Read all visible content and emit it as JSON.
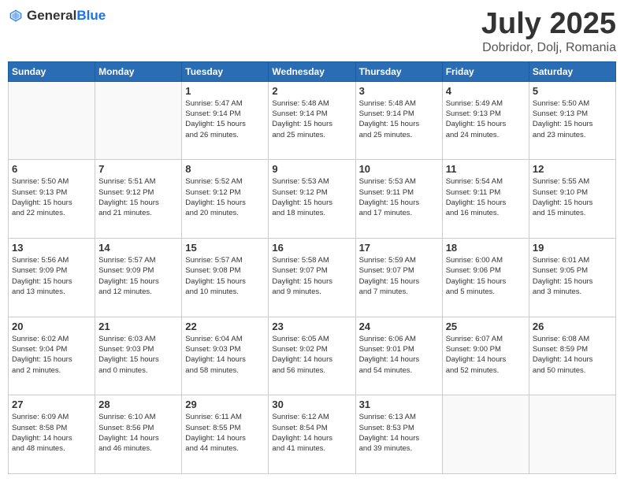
{
  "header": {
    "logo_general": "General",
    "logo_blue": "Blue",
    "main_title": "July 2025",
    "subtitle": "Dobridor, Dolj, Romania"
  },
  "weekdays": [
    "Sunday",
    "Monday",
    "Tuesday",
    "Wednesday",
    "Thursday",
    "Friday",
    "Saturday"
  ],
  "weeks": [
    [
      {
        "day": "",
        "info": ""
      },
      {
        "day": "",
        "info": ""
      },
      {
        "day": "1",
        "info": "Sunrise: 5:47 AM\nSunset: 9:14 PM\nDaylight: 15 hours\nand 26 minutes."
      },
      {
        "day": "2",
        "info": "Sunrise: 5:48 AM\nSunset: 9:14 PM\nDaylight: 15 hours\nand 25 minutes."
      },
      {
        "day": "3",
        "info": "Sunrise: 5:48 AM\nSunset: 9:14 PM\nDaylight: 15 hours\nand 25 minutes."
      },
      {
        "day": "4",
        "info": "Sunrise: 5:49 AM\nSunset: 9:13 PM\nDaylight: 15 hours\nand 24 minutes."
      },
      {
        "day": "5",
        "info": "Sunrise: 5:50 AM\nSunset: 9:13 PM\nDaylight: 15 hours\nand 23 minutes."
      }
    ],
    [
      {
        "day": "6",
        "info": "Sunrise: 5:50 AM\nSunset: 9:13 PM\nDaylight: 15 hours\nand 22 minutes."
      },
      {
        "day": "7",
        "info": "Sunrise: 5:51 AM\nSunset: 9:12 PM\nDaylight: 15 hours\nand 21 minutes."
      },
      {
        "day": "8",
        "info": "Sunrise: 5:52 AM\nSunset: 9:12 PM\nDaylight: 15 hours\nand 20 minutes."
      },
      {
        "day": "9",
        "info": "Sunrise: 5:53 AM\nSunset: 9:12 PM\nDaylight: 15 hours\nand 18 minutes."
      },
      {
        "day": "10",
        "info": "Sunrise: 5:53 AM\nSunset: 9:11 PM\nDaylight: 15 hours\nand 17 minutes."
      },
      {
        "day": "11",
        "info": "Sunrise: 5:54 AM\nSunset: 9:11 PM\nDaylight: 15 hours\nand 16 minutes."
      },
      {
        "day": "12",
        "info": "Sunrise: 5:55 AM\nSunset: 9:10 PM\nDaylight: 15 hours\nand 15 minutes."
      }
    ],
    [
      {
        "day": "13",
        "info": "Sunrise: 5:56 AM\nSunset: 9:09 PM\nDaylight: 15 hours\nand 13 minutes."
      },
      {
        "day": "14",
        "info": "Sunrise: 5:57 AM\nSunset: 9:09 PM\nDaylight: 15 hours\nand 12 minutes."
      },
      {
        "day": "15",
        "info": "Sunrise: 5:57 AM\nSunset: 9:08 PM\nDaylight: 15 hours\nand 10 minutes."
      },
      {
        "day": "16",
        "info": "Sunrise: 5:58 AM\nSunset: 9:07 PM\nDaylight: 15 hours\nand 9 minutes."
      },
      {
        "day": "17",
        "info": "Sunrise: 5:59 AM\nSunset: 9:07 PM\nDaylight: 15 hours\nand 7 minutes."
      },
      {
        "day": "18",
        "info": "Sunrise: 6:00 AM\nSunset: 9:06 PM\nDaylight: 15 hours\nand 5 minutes."
      },
      {
        "day": "19",
        "info": "Sunrise: 6:01 AM\nSunset: 9:05 PM\nDaylight: 15 hours\nand 3 minutes."
      }
    ],
    [
      {
        "day": "20",
        "info": "Sunrise: 6:02 AM\nSunset: 9:04 PM\nDaylight: 15 hours\nand 2 minutes."
      },
      {
        "day": "21",
        "info": "Sunrise: 6:03 AM\nSunset: 9:03 PM\nDaylight: 15 hours\nand 0 minutes."
      },
      {
        "day": "22",
        "info": "Sunrise: 6:04 AM\nSunset: 9:03 PM\nDaylight: 14 hours\nand 58 minutes."
      },
      {
        "day": "23",
        "info": "Sunrise: 6:05 AM\nSunset: 9:02 PM\nDaylight: 14 hours\nand 56 minutes."
      },
      {
        "day": "24",
        "info": "Sunrise: 6:06 AM\nSunset: 9:01 PM\nDaylight: 14 hours\nand 54 minutes."
      },
      {
        "day": "25",
        "info": "Sunrise: 6:07 AM\nSunset: 9:00 PM\nDaylight: 14 hours\nand 52 minutes."
      },
      {
        "day": "26",
        "info": "Sunrise: 6:08 AM\nSunset: 8:59 PM\nDaylight: 14 hours\nand 50 minutes."
      }
    ],
    [
      {
        "day": "27",
        "info": "Sunrise: 6:09 AM\nSunset: 8:58 PM\nDaylight: 14 hours\nand 48 minutes."
      },
      {
        "day": "28",
        "info": "Sunrise: 6:10 AM\nSunset: 8:56 PM\nDaylight: 14 hours\nand 46 minutes."
      },
      {
        "day": "29",
        "info": "Sunrise: 6:11 AM\nSunset: 8:55 PM\nDaylight: 14 hours\nand 44 minutes."
      },
      {
        "day": "30",
        "info": "Sunrise: 6:12 AM\nSunset: 8:54 PM\nDaylight: 14 hours\nand 41 minutes."
      },
      {
        "day": "31",
        "info": "Sunrise: 6:13 AM\nSunset: 8:53 PM\nDaylight: 14 hours\nand 39 minutes."
      },
      {
        "day": "",
        "info": ""
      },
      {
        "day": "",
        "info": ""
      }
    ]
  ]
}
